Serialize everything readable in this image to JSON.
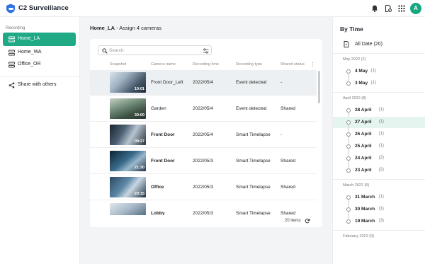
{
  "app": {
    "title": "C2 Surveillance",
    "avatar_letter": "A",
    "accent": "#1faa85"
  },
  "topbar_icons": [
    "bell-icon",
    "document-settings-icon",
    "grid-apps-icon"
  ],
  "sidebar": {
    "section_label": "Recording",
    "items": [
      {
        "label": "Home_LA",
        "active": true,
        "icon": "camera-group-icon"
      },
      {
        "label": "Home_WA",
        "active": false,
        "icon": "camera-group-icon"
      },
      {
        "label": "Office_OR",
        "active": false,
        "icon": "camera-group-icon"
      }
    ],
    "share_label": "Share with others"
  },
  "main": {
    "title": "Home_LA",
    "subtitle": " - Assign 4 cameras",
    "search_placeholder": "Search",
    "columns": [
      "Snapshot",
      "Camera name",
      "Recording time",
      "Recording type",
      "Shared status"
    ],
    "rows": [
      {
        "duration": "10:01",
        "camera": "Front Door_Left",
        "time": "2022/05/4",
        "type": "Event detected",
        "shared": "-",
        "selected": true
      },
      {
        "duration": "30:00",
        "camera": "Garden",
        "time": "2022/05/4",
        "type": "Event detected",
        "shared": "Shared",
        "selected": false
      },
      {
        "duration": "09:27",
        "camera": "Front Door",
        "time": "2022/05/4",
        "type": "Smart Timelapse",
        "shared": "-",
        "selected": false
      },
      {
        "duration": "21:30",
        "camera": "Front Door",
        "time": "2022/05/3",
        "type": "Smart Timelapse",
        "shared": "Shared",
        "selected": false
      },
      {
        "duration": "20:15",
        "camera": "Office",
        "time": "2022/05/3",
        "type": "Smart Timelapse",
        "shared": "Shared",
        "selected": false
      },
      {
        "duration": "",
        "camera": "Lobby",
        "time": "2022/05/3",
        "type": "Smart Timelapse",
        "shared": "Shared",
        "selected": false
      }
    ],
    "items_count": "20 items"
  },
  "by_time": {
    "title": "By Time",
    "all_date": "All Date (20)",
    "months": [
      {
        "label": "May 2022 (2)",
        "days": [
          {
            "label": "4 May",
            "count": "(1)"
          },
          {
            "label": "3 May",
            "count": "(1)"
          }
        ]
      },
      {
        "label": "April 2022 (8)",
        "days": [
          {
            "label": "28 April",
            "count": "(1)"
          },
          {
            "label": "27 April",
            "count": "(1)",
            "active": true
          },
          {
            "label": "26 April",
            "count": "(1)"
          },
          {
            "label": "25 April",
            "count": "(1)"
          },
          {
            "label": "24 April",
            "count": "(2)"
          },
          {
            "label": "23 April",
            "count": "(2)"
          }
        ]
      },
      {
        "label": "March 2022 (5)",
        "days": [
          {
            "label": "31 March",
            "count": "(1)"
          },
          {
            "label": "30 March",
            "count": "(1)"
          },
          {
            "label": "19 March",
            "count": "(3)"
          }
        ]
      },
      {
        "label": "February 2022 (9)",
        "days": []
      }
    ]
  }
}
